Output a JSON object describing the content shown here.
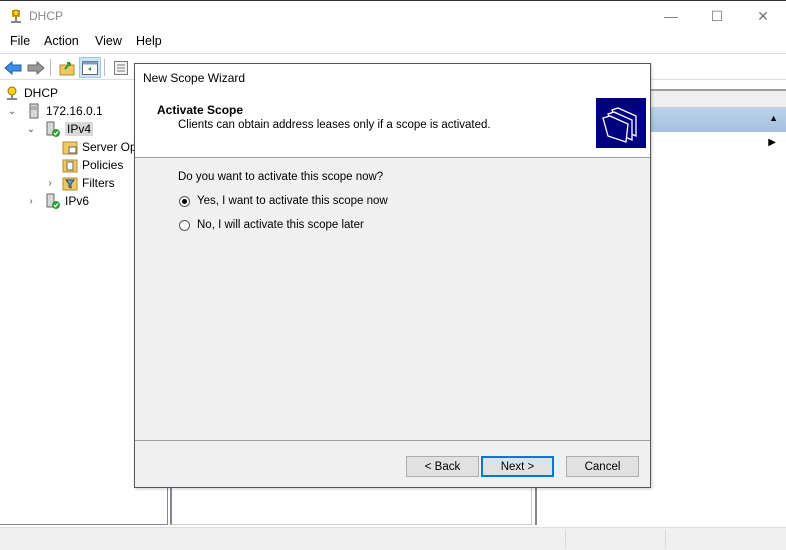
{
  "window": {
    "title": "DHCP",
    "controls": {
      "minimize": "—",
      "maximize": "☐",
      "close": "✕"
    }
  },
  "menu": [
    "File",
    "Action",
    "View",
    "Help"
  ],
  "toolbar": {
    "buttons": [
      "back-arrow",
      "forward-arrow",
      "up-folder",
      "show-hide-console-tree",
      "export-list",
      "properties",
      "help",
      "show-action-pane",
      "display-statistics"
    ]
  },
  "tree": {
    "items": [
      {
        "label": "DHCP",
        "level": 0,
        "expander": ""
      },
      {
        "label": "172.16.0.1",
        "level": 1,
        "expander": "⌄"
      },
      {
        "label": "IPv4",
        "level": 2,
        "expander": "⌄",
        "selected": true
      },
      {
        "label": "Server Op",
        "level": 3,
        "expander": ""
      },
      {
        "label": "Policies",
        "level": 3,
        "expander": ""
      },
      {
        "label": "Filters",
        "level": 3,
        "expander": "›"
      },
      {
        "label": "IPv6",
        "level": 2,
        "expander": "›"
      }
    ]
  },
  "actions": {
    "collapse_glyph": "▲",
    "more_glyph": "▶"
  },
  "dialog": {
    "title": "New Scope Wizard",
    "heading": "Activate Scope",
    "subheading": "Clients can obtain address leases only if a scope is activated.",
    "question": "Do you want to activate this scope now?",
    "options": [
      {
        "label": "Yes, I want to activate this scope now",
        "checked": true
      },
      {
        "label": "No, I will activate this scope later",
        "checked": false
      }
    ],
    "buttons": {
      "back": "< Back",
      "next": "Next >",
      "cancel": "Cancel"
    },
    "icon_bg": "#000080"
  }
}
